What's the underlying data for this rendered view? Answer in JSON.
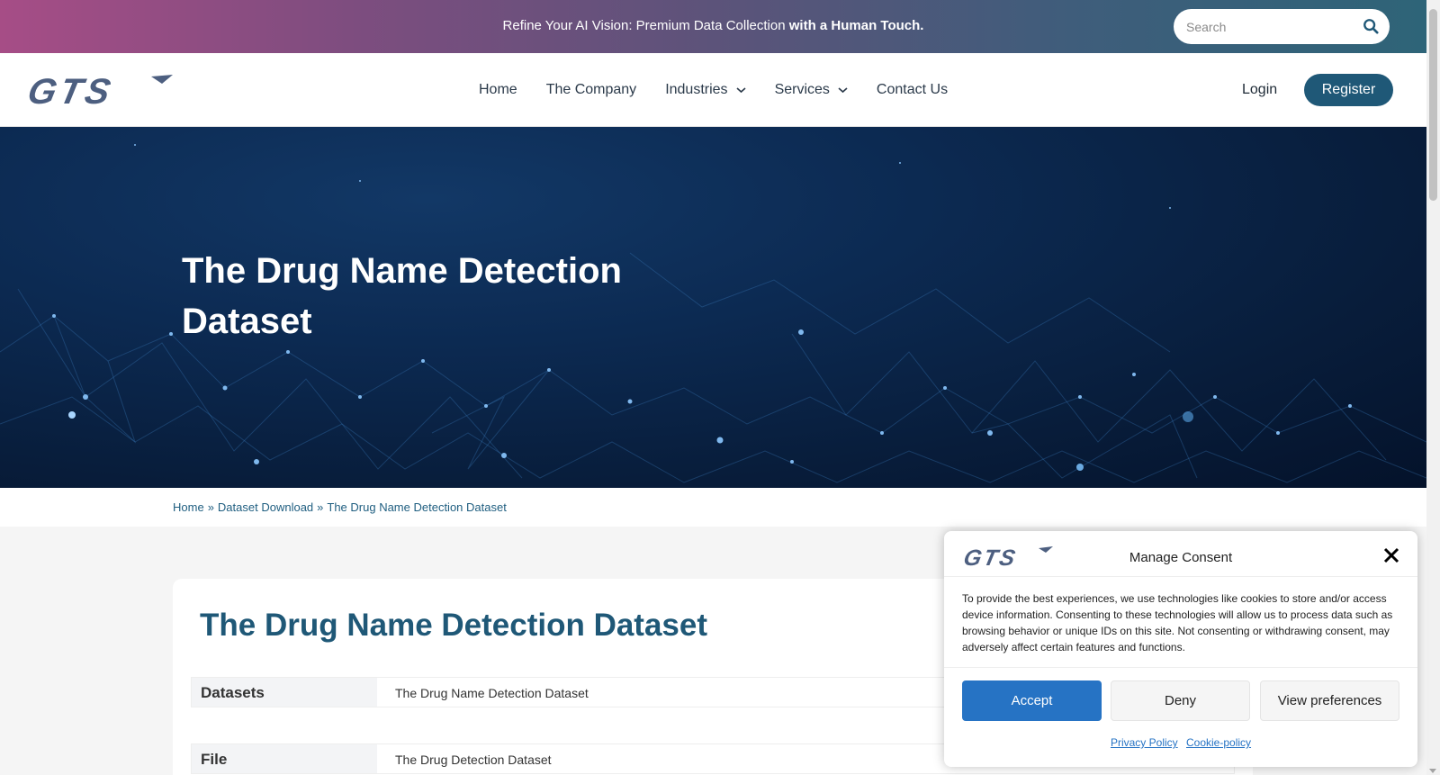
{
  "topbar": {
    "text_normal": "Refine Your AI Vision: Premium Data Collection ",
    "text_bold": "with a Human Touch.",
    "search_placeholder": "Search"
  },
  "header": {
    "logo_text": "GTS",
    "nav": [
      {
        "label": "Home"
      },
      {
        "label": "The Company"
      },
      {
        "label": "Industries"
      },
      {
        "label": "Services"
      },
      {
        "label": "Contact Us"
      }
    ],
    "login": "Login",
    "register": "Register"
  },
  "hero": {
    "title": "The Drug Name Detection Dataset"
  },
  "breadcrumb": {
    "items": [
      "Home",
      "Dataset Download",
      "The Drug Name Detection Dataset"
    ],
    "separator": "»"
  },
  "content": {
    "title": "The Drug Name Detection Dataset",
    "rows": [
      {
        "label": "Datasets",
        "value": "The Drug Name Detection Dataset"
      },
      {
        "label": "File",
        "value": "The Drug Detection Dataset"
      }
    ]
  },
  "consent": {
    "title": "Manage Consent",
    "body": "To provide the best experiences, we use technologies like cookies to store and/or access device information. Consenting to these technologies will allow us to process data such as browsing behavior or unique IDs on this site. Not consenting or withdrawing consent, may adversely affect certain features and functions.",
    "accept": "Accept",
    "deny": "Deny",
    "view_preferences": "View preferences",
    "privacy_policy": "Privacy Policy",
    "cookie_policy": "Cookie-policy"
  },
  "colors": {
    "brand_primary": "#1f5877",
    "accept_blue": "#2673c4",
    "logo_slate": "#4d5f80"
  }
}
